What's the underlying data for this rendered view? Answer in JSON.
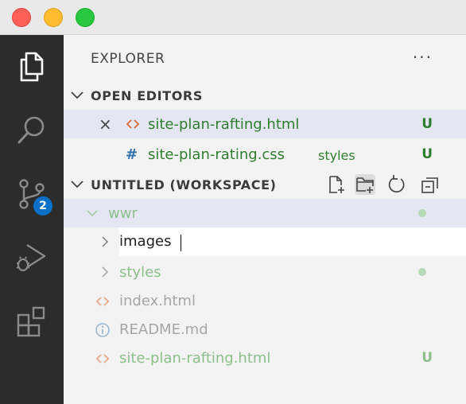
{
  "window": {
    "controls": [
      "close",
      "minimize",
      "maximize"
    ]
  },
  "activity_bar": {
    "items": [
      {
        "name": "explorer",
        "icon": "files-icon",
        "active": true
      },
      {
        "name": "search",
        "icon": "search-icon"
      },
      {
        "name": "source-control",
        "icon": "source-control-icon",
        "badge": "2"
      },
      {
        "name": "run-debug",
        "icon": "run-debug-icon"
      },
      {
        "name": "extensions",
        "icon": "extensions-icon"
      }
    ]
  },
  "explorer": {
    "title": "EXPLORER",
    "more": "···",
    "open_editors": {
      "label": "OPEN EDITORS",
      "items": [
        {
          "name": "site-plan-rafting.html",
          "status": "U",
          "icon": "html-icon",
          "close": "×"
        },
        {
          "name": "site-plan-rating.css",
          "description": "styles",
          "status": "U",
          "icon": "#"
        }
      ]
    },
    "workspace": {
      "label": "UNTITLED (WORKSPACE)",
      "actions": [
        "new-file-icon",
        "new-folder-icon",
        "refresh-icon",
        "collapse-all-icon"
      ],
      "tree": {
        "root": "wwr",
        "rename_input": "images",
        "children": [
          {
            "name": "styles",
            "type": "folder"
          },
          {
            "name": "index.html",
            "type": "file",
            "icon": "html-icon"
          },
          {
            "name": "README.md",
            "type": "file",
            "icon": "info-icon"
          },
          {
            "name": "site-plan-rafting.html",
            "type": "file",
            "icon": "html-icon",
            "status": "U"
          }
        ]
      }
    }
  },
  "colors": {
    "git_untracked": "#2f7d2f",
    "git_untracked_faded": "#8cbf8c",
    "selection": "#e4e6f1",
    "activity_bg": "#2c2c2c",
    "badge": "#0b71c8",
    "html_icon": "#d86b3c",
    "css_icon": "#2f6fae"
  }
}
